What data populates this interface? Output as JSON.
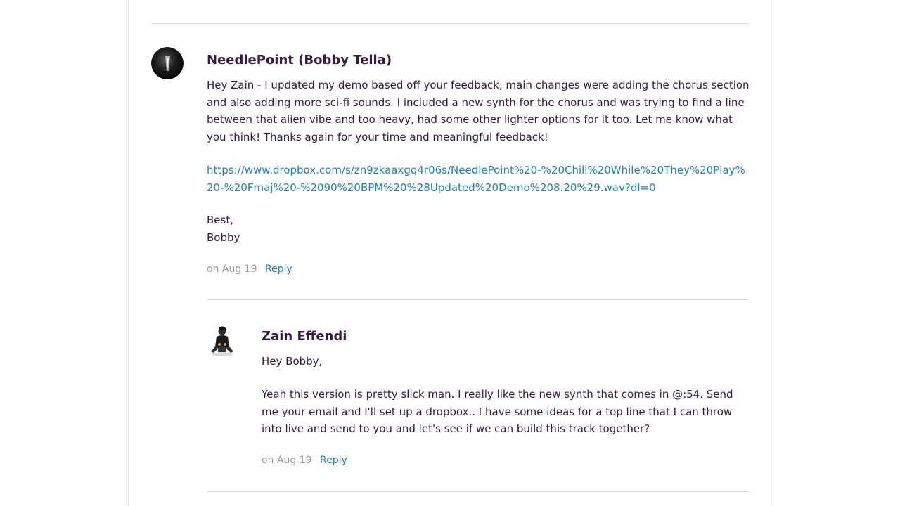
{
  "comments": [
    {
      "author": "NeedlePoint (Bobby Tella)",
      "avatar_icon": "dark-circle-avatar",
      "paragraph": "Hey Zain - I updated my demo based off your feedback, main changes were adding the chorus section and also adding more sci-fi sounds. I included a new synth for the chorus and was trying to find a line between that alien vibe and too heavy, had some other lighter options for it too. Let me know what you think! Thanks again for your time and meaningful feedback!",
      "link": "https://www.dropbox.com/s/zn9zkaaxgq4r06s/NeedlePoint%20-%20Chill%20While%20They%20Play%20-%20Fmaj%20-%2090%20BPM%20%28Updated%20Demo%208.20%29.wav?dl=0",
      "signoff_1": "Best,",
      "signoff_2": "Bobby",
      "date": "on Aug 19",
      "reply_label": "Reply"
    },
    {
      "author": "Zain Effendi",
      "avatar_icon": "person-photo-avatar",
      "greeting": "Hey Bobby,",
      "paragraph": "Yeah this version is pretty slick man. I really like the new synth that comes in @:54. Send me your email and I'll set up a dropbox.. I have some ideas for a top line that I can throw into live and send to you and let's see if we can build this track together?",
      "date": "on Aug 19",
      "reply_label": "Reply"
    }
  ],
  "colors": {
    "text": "#3a1746",
    "link": "#1f7fc4",
    "meta": "#9a9a9a",
    "divider": "#dcdcdc"
  }
}
